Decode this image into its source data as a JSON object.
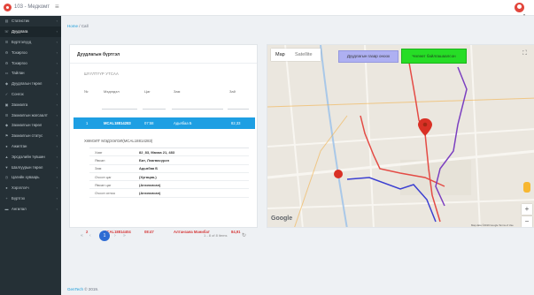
{
  "app": {
    "title": "103 - Медкомт"
  },
  "sidebar": {
    "items": [
      {
        "label": "Статистик",
        "icon": "chart-icon"
      },
      {
        "label": "Дуудлага",
        "icon": "phone-icon"
      },
      {
        "label": "Бүртгэлүүд",
        "icon": "list-icon"
      },
      {
        "label": "Тохиргоо",
        "icon": "gear-icon"
      },
      {
        "label": "Тохиргоо",
        "icon": "gear-icon"
      },
      {
        "label": "Тайлан",
        "icon": "file-icon"
      },
      {
        "label": "Дуудлагын төрөл",
        "icon": "tag-icon"
      },
      {
        "label": "Сонгох",
        "icon": "check-icon"
      },
      {
        "label": "Захиалга",
        "icon": "cart-icon"
      },
      {
        "label": "Захиалгын жагсаалт",
        "icon": "list-icon"
      },
      {
        "label": "Захиалгын төрөл",
        "icon": "tag-icon"
      },
      {
        "label": "Захиалгын статус",
        "icon": "flag-icon"
      },
      {
        "label": "Ажилтан",
        "icon": "user-icon"
      },
      {
        "label": "Эрсдэлийн түвшин",
        "icon": "warning-icon"
      },
      {
        "label": "Шалгуурын төрөл",
        "icon": "filter-icon"
      },
      {
        "label": "Цагийн хуваарь",
        "icon": "clock-icon"
      },
      {
        "label": "Хэрэглэгч",
        "icon": "user-icon"
      },
      {
        "label": "Бүртгэх",
        "icon": "plus-icon"
      },
      {
        "label": "Ангилал",
        "icon": "folder-icon"
      }
    ]
  },
  "breadcrumb": {
    "home": "Home",
    "sep": "/",
    "current": "Call"
  },
  "list": {
    "title": "Дуудлагын бүртгэл",
    "filter_label": "ШҮҮЛТҮҮР УТСАА",
    "columns": [
      "№",
      "Мэдэгдэл",
      "Цаг",
      "Зам",
      "Зай"
    ],
    "selected_row": {
      "num": "1",
      "code": "MCAL18814283",
      "time": "07:58",
      "name": "Адьябаа Б",
      "dist": "82,33"
    },
    "detail_header": "ХӨМЭЛТ МЭДЭЭЛЭЛ(MCAL18814283)",
    "detail_rows": [
      {
        "key": "Хаяг",
        "value": "82_83, Махаа 21, 483"
      },
      {
        "key": "Явсан",
        "value": "Бат, Лхагвасүрэн"
      },
      {
        "key": "Зам",
        "value": "Адьябаа Б"
      },
      {
        "key": "Очсон цаг",
        "value": "(Хугацаа-)"
      },
      {
        "key": "Явсан цаг",
        "value": "(Анхлалсан)"
      },
      {
        "key": "Очсон огноо",
        "value": "(Анхлалсан)"
      }
    ],
    "second_row": {
      "num": "2",
      "code": "MCAL18814404",
      "time": "08:47",
      "name": "Алтанзаяа Манибат",
      "dist": "84,91"
    }
  },
  "pagination": {
    "first": "«",
    "prev": "‹",
    "current": "1",
    "next": "›",
    "last": "»",
    "info": "1 - 8 of 8 items",
    "refresh": "↻"
  },
  "map": {
    "tab_map": "Map",
    "tab_satellite": "Satellite",
    "route_button": "Дуудлагын газар оноох",
    "realtime_button": "Чөлөөт байлгашаалсон",
    "fullscreen": "⛶",
    "zoom_in": "+",
    "zoom_out": "−",
    "google": "Google",
    "footer": "Map data ©2019 Google  Terms of Use",
    "colors": {
      "route_red": "#e44b45",
      "route_blue": "#3b3fd1",
      "route_purple": "#7b3fc0",
      "marker": "#d93025"
    }
  },
  "footer": {
    "company": "GenTech",
    "text": "© 2019."
  }
}
